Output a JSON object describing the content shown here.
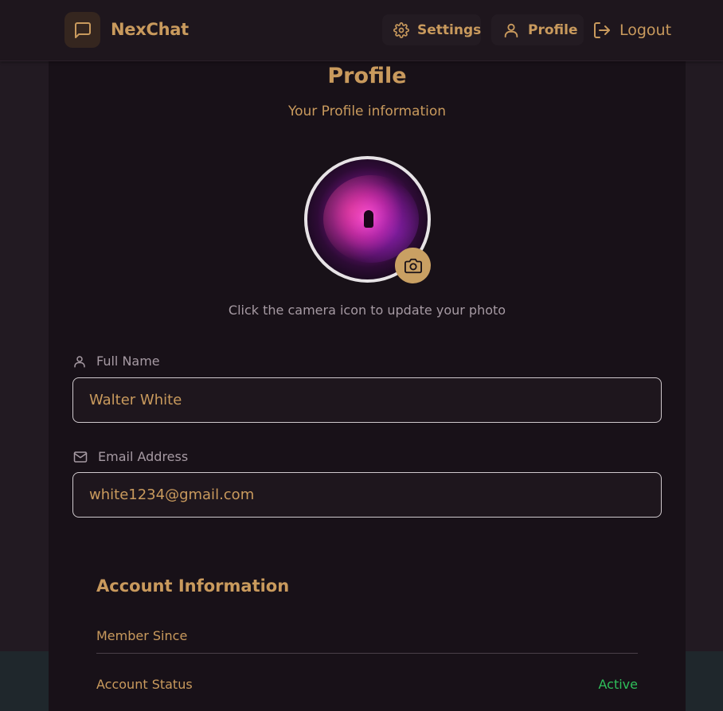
{
  "app": {
    "name": "NexChat",
    "brand_icon": "chat-bubble-icon"
  },
  "nav": {
    "settings_label": "Settings",
    "profile_label": "Profile",
    "logout_label": "Logout"
  },
  "profile": {
    "title": "Profile",
    "subtitle": "Your Profile information",
    "photo_hint": "Click the camera icon to update your photo"
  },
  "form": {
    "full_name_label": "Full Name",
    "full_name_value": "Walter White",
    "email_label": "Email Address",
    "email_value": "white1234@gmail.com"
  },
  "account": {
    "section_title": "Account Information",
    "member_since_label": "Member Since",
    "member_since_value": "",
    "status_label": "Account Status",
    "status_value": "Active"
  },
  "colors": {
    "accent": "#c99a5d",
    "active_status": "#2fbf5a",
    "background": "#221a22",
    "card": "#181118"
  }
}
